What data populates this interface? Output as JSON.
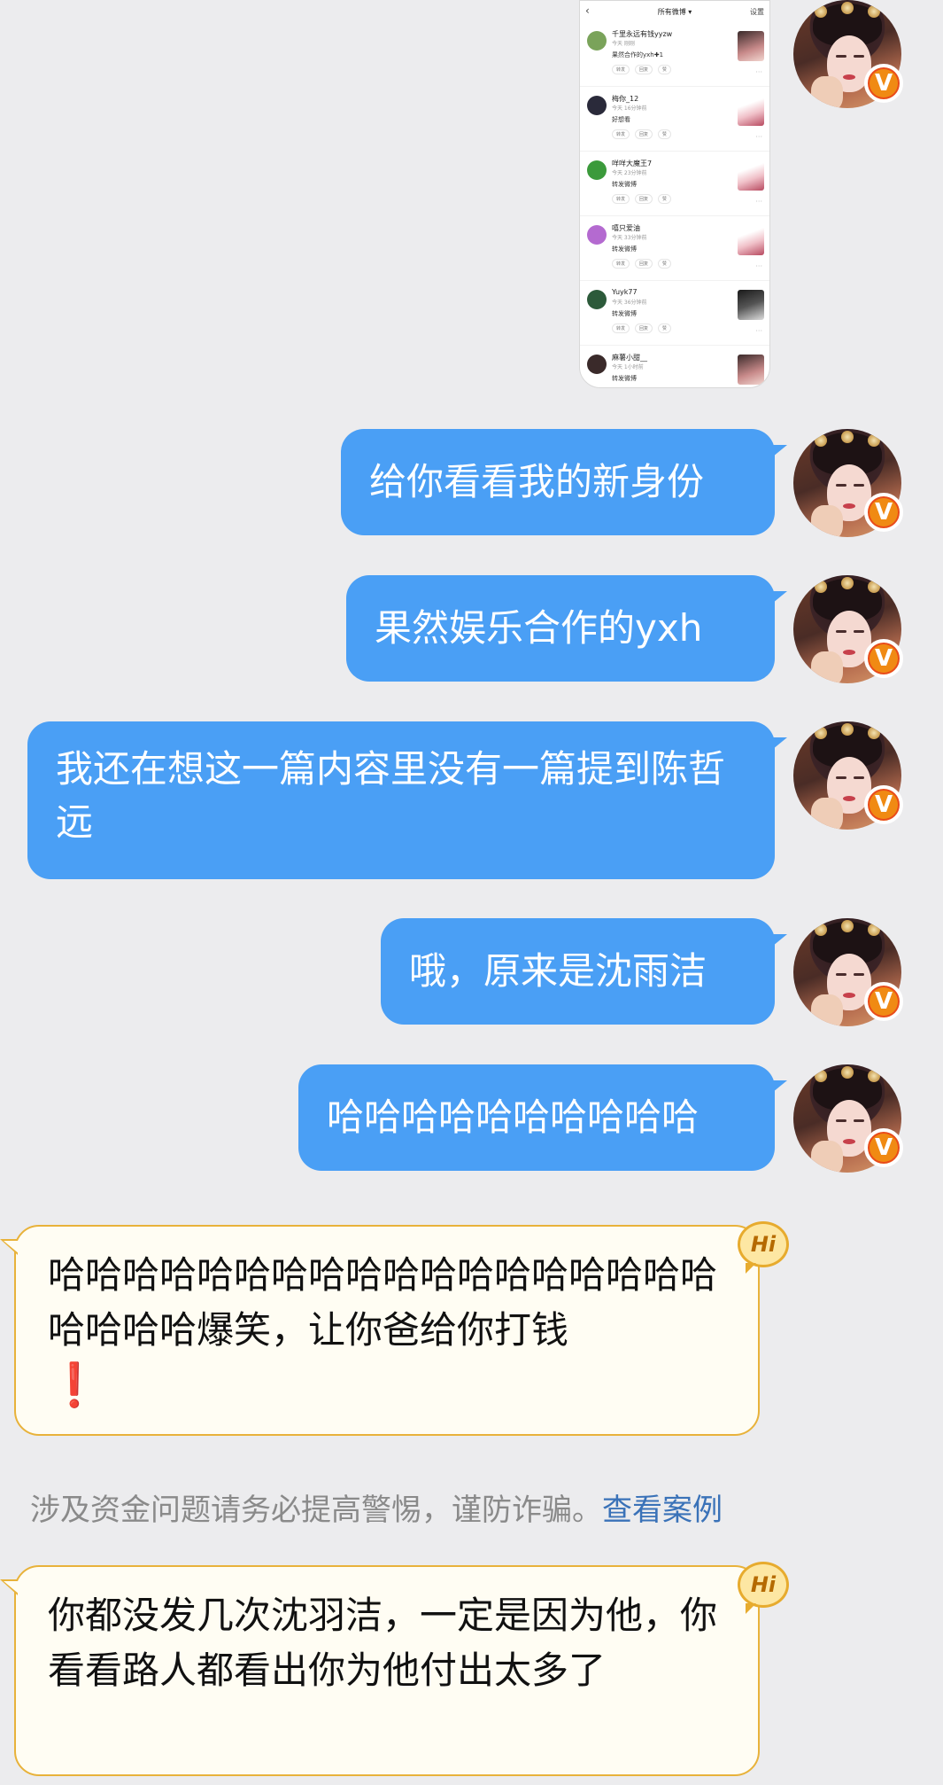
{
  "shared_screenshot": {
    "header_title": "所有微博",
    "settings": "设置",
    "items": [
      {
        "name": "千里永远有钱yyzw",
        "time": "今天  刚刚",
        "text": "果然合作的yxh✚1",
        "avatar_color": "#7aa35a",
        "thumb": "normal"
      },
      {
        "name": "梅你_12",
        "time": "今天  16分钟前",
        "text": "好想看",
        "avatar_color": "#2a2a3a",
        "thumb": "light"
      },
      {
        "name": "咩咩大魔王7",
        "time": "今天  23分钟前",
        "text": "转发微博",
        "avatar_color": "#3b9a3b",
        "thumb": "light"
      },
      {
        "name": "嘻只爱油",
        "time": "今天  33分钟前",
        "text": "转发微博",
        "avatar_color": "#b46ad0",
        "thumb": "light"
      },
      {
        "name": "Yuyk77",
        "time": "今天  36分钟前",
        "text": "转发微博",
        "avatar_color": "#2c5a3a",
        "thumb": "dark"
      },
      {
        "name": "麻薯小甜__",
        "time": "今天  1小时前",
        "text": "转发微博",
        "avatar_color": "#3a2a2a",
        "thumb": "normal"
      }
    ],
    "actions": [
      "转发",
      "回复",
      "赞"
    ]
  },
  "messages_out": [
    {
      "text": "给你看看我的新身份"
    },
    {
      "text": "果然娱乐合作的yxh"
    },
    {
      "text": "我还在想这一篇内容里没有一篇提到陈哲远"
    },
    {
      "text": "哦，原来是沈雨洁"
    },
    {
      "text": "哈哈哈哈哈哈哈哈哈哈"
    }
  ],
  "messages_in": [
    {
      "text": "哈哈哈哈哈哈哈哈哈哈哈哈哈哈哈哈哈哈哈哈哈哈爆笑，让你爸给你打钱",
      "exclaim": "❗"
    },
    {
      "text": "你都没发几次沈羽洁，一定是因为他，你看看路人都看出你为他付出太多了"
    }
  ],
  "hi_badge": "Hi",
  "verified_badge": "V",
  "warning": {
    "text": "涉及资金问题请务必提高警惕，谨防诈骗。",
    "link": "查看案例"
  },
  "colors": {
    "background": "#ececee",
    "bubble_out": "#4a9ff5",
    "bubble_in_fill": "#fffdf3",
    "bubble_in_border": "#e8b23a",
    "link": "#3a72b8"
  }
}
